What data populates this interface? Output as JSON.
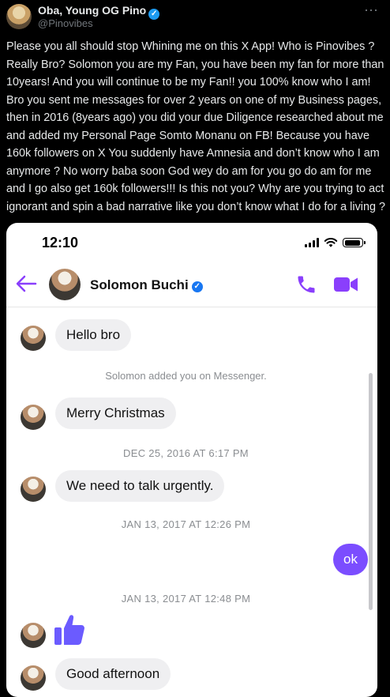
{
  "post": {
    "author_name": "Oba, Young OG Pino",
    "handle": "@Pinovibes",
    "verified_icon": "verified-badge-icon",
    "more_icon": "more-options-icon",
    "text": "Please you all should stop Whining me on this X App! Who is Pinovibes ? Really Bro? Solomon you are my Fan, you have been my fan for more than 10years! And you will continue to be my Fan!! you 100% know who I am! Bro you sent me messages for over 2 years on one of my Business pages,  then in 2016 (8years ago) you did your due Diligence researched about me and added my Personal Page Somto Monanu on FB! Because you have 160k followers on X You suddenly have Amnesia and don’t know who I am anymore ? No worry baba soon God wey do am for you go do am for me and I go also get 160k followers!!! Is this not you? Why are you trying to act ignorant and spin a bad narrative like you don’t know what I do for a living ?"
  },
  "screenshot": {
    "status_time": "12:10",
    "contact_name": "Solomon Buchi",
    "accent_color": "#8a3ffc",
    "messages": [
      {
        "type": "received",
        "text": "Hello bro"
      },
      {
        "type": "system",
        "text": "Solomon added you on Messenger."
      },
      {
        "type": "received",
        "text": "Merry Christmas"
      },
      {
        "type": "timestamp",
        "text": "DEC 25, 2016 AT 6:17 PM"
      },
      {
        "type": "received",
        "text": "We need to talk urgently."
      },
      {
        "type": "timestamp",
        "text": "JAN 13, 2017 AT 12:26 PM"
      },
      {
        "type": "sent",
        "text": "ok"
      },
      {
        "type": "timestamp",
        "text": "JAN 13, 2017 AT 12:48 PM"
      },
      {
        "type": "received-like",
        "icon": "thumbs-up-icon"
      },
      {
        "type": "received",
        "text": "Good afternoon"
      }
    ]
  }
}
